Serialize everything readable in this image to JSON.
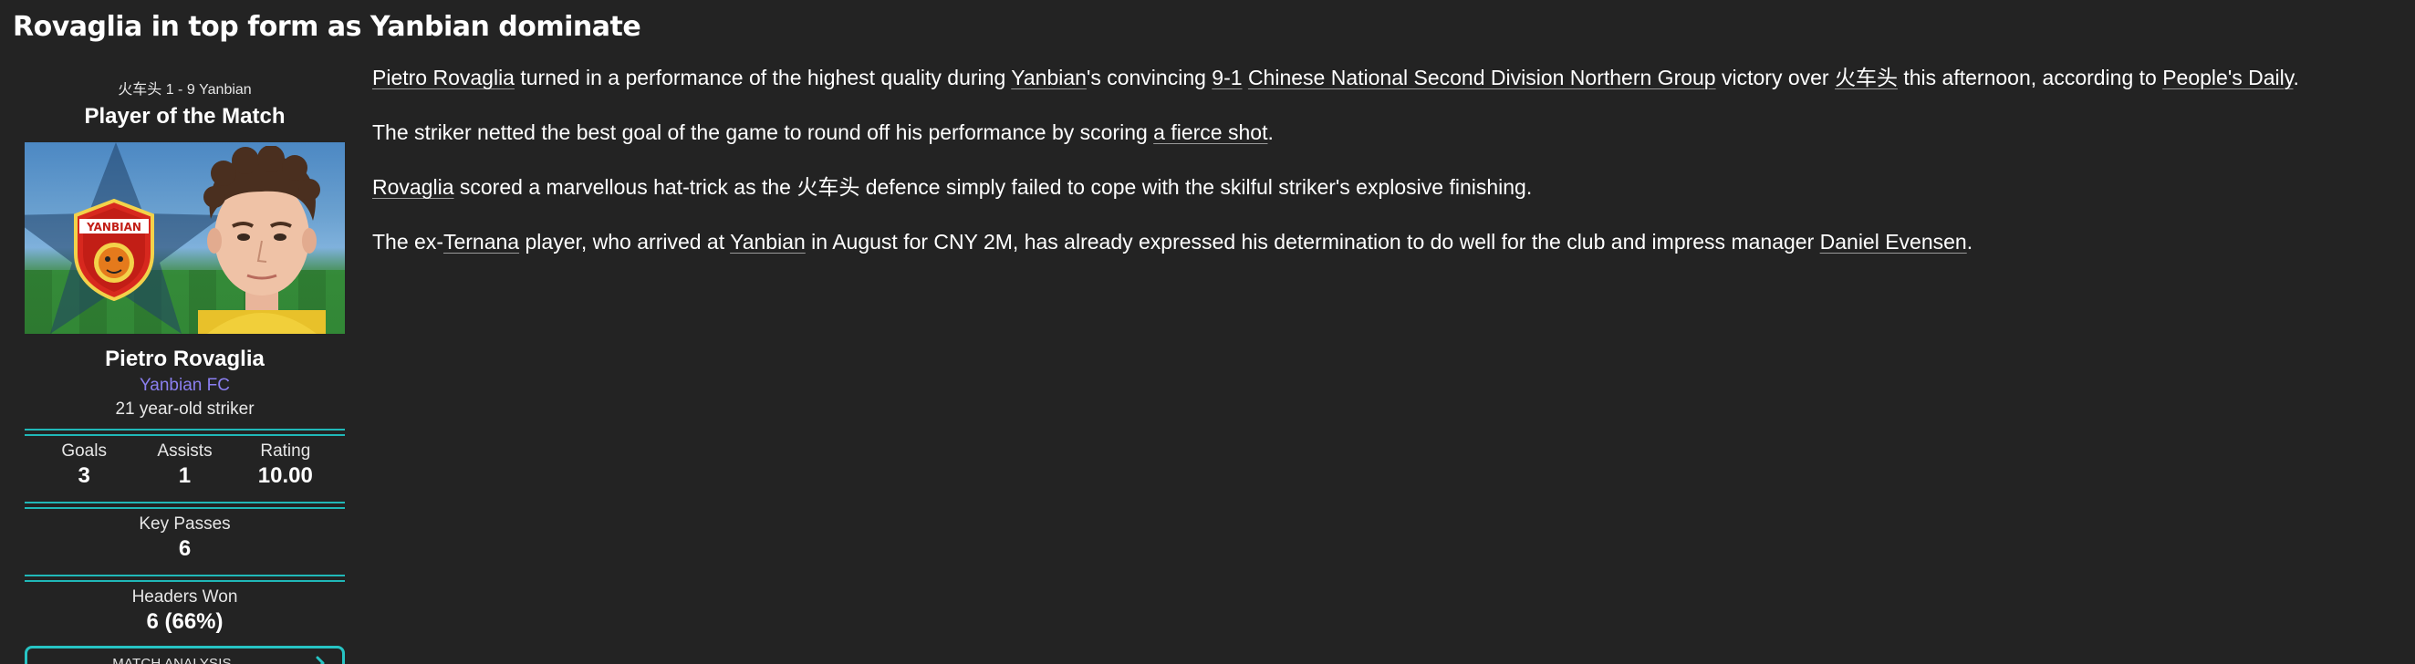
{
  "headline": "Rovaglia in top form as Yanbian dominate",
  "card": {
    "score_line": "火车头 1 - 9 Yanbian",
    "title": "Player of the Match",
    "player_name": "Pietro Rovaglia",
    "club": "Yanbian FC",
    "description": "21 year-old striker",
    "badge_text": "YANBIAN",
    "stats": [
      {
        "label": "Goals",
        "value": "3"
      },
      {
        "label": "Assists",
        "value": "1"
      },
      {
        "label": "Rating",
        "value": "10.00"
      }
    ],
    "key_passes": {
      "label": "Key Passes",
      "value": "6"
    },
    "headers_won": {
      "label": "Headers Won",
      "value": "6 (66%)"
    },
    "button_label": "MATCH ANALYSIS",
    "accent_color": "#20b8b8",
    "club_color": "#8b7ff0"
  },
  "article": {
    "p1": {
      "player": "Pietro Rovaglia",
      "t1": " turned in a performance of the highest quality during ",
      "team": "Yanbian",
      "t2": "'s convincing ",
      "score": "9-1",
      "t3": " ",
      "competition": "Chinese National Second Division Northern Group",
      "t4": " victory over ",
      "opponent": "火车头",
      "t5": " this afternoon, according to ",
      "source": "People's Daily",
      "t6": "."
    },
    "p2": {
      "t1": "The striker netted the best goal of the game to round off his performance by scoring ",
      "goal": "a fierce shot",
      "t2": "."
    },
    "p3": {
      "player": "Rovaglia",
      "t1": " scored a marvellous hat-trick as the ",
      "opponent": "火车头",
      "t2": " defence simply failed to cope with the skilful striker's explosive finishing."
    },
    "p4": {
      "t1": "The ex-",
      "old_club": "Ternana",
      "t2": " player, who arrived at ",
      "team": "Yanbian",
      "t3": " in August for CNY 2M, has already expressed his determination to do well for the club and impress manager ",
      "manager": "Daniel Evensen",
      "t4": "."
    }
  }
}
